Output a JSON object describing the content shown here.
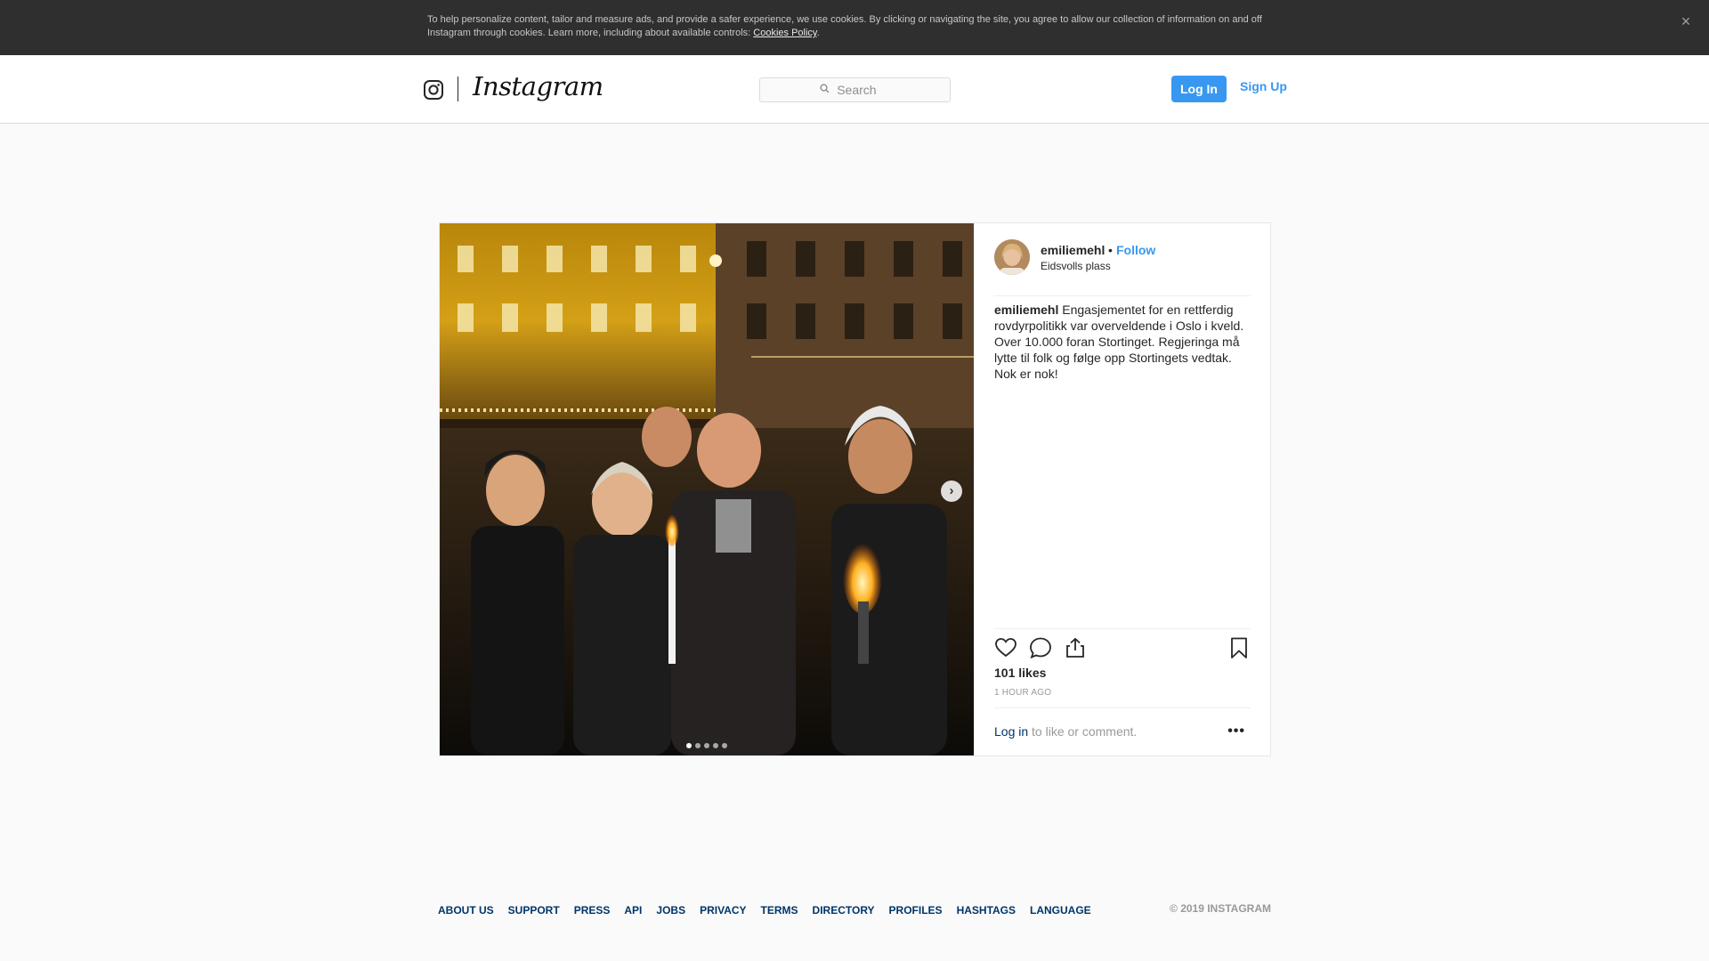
{
  "cookie_banner": {
    "text": "To help personalize content, tailor and measure ads, and provide a safer experience, we use cookies. By clicking or navigating the site, you agree to allow our collection of information on and off Instagram through cookies. Learn more, including about available controls: ",
    "link": "Cookies Policy",
    "period": ".",
    "close_glyph": "×"
  },
  "nav": {
    "logo": "Instagram",
    "search_placeholder": "Search",
    "search_icon": "search-icon",
    "login_label": "Log In",
    "signup_label": "Sign Up"
  },
  "post": {
    "username": "emiliemehl",
    "separator": "•",
    "follow_label": "Follow",
    "location": "Eidsvolls plass",
    "caption": "Engasjementet for en rettferdig rovdyrpolitikk var overveldende i Oslo i kveld. Over 10.000 foran Stortinget. Regjeringa må lytte til folk og følge opp Stortingets vedtak. Nok er nok!⁠ ⁠",
    "likes": "101 likes",
    "time": "1 HOUR AGO",
    "comment_login": "Log in",
    "comment_rest": " to like or comment.",
    "more_glyph": "•••",
    "next_glyph": "›",
    "carousel_count": 5,
    "carousel_active": 1,
    "icons": [
      "heart-icon",
      "comment-icon",
      "share-icon",
      "bookmark-icon"
    ]
  },
  "footer": {
    "links": [
      "ABOUT US",
      "SUPPORT",
      "PRESS",
      "API",
      "JOBS",
      "PRIVACY",
      "TERMS",
      "DIRECTORY",
      "PROFILES",
      "HASHTAGS",
      "LANGUAGE"
    ],
    "copyright": "© 2019 INSTAGRAM"
  },
  "colors": {
    "accent": "#3897f0",
    "banner": "#2f2f2f",
    "link_dark": "#003569"
  }
}
